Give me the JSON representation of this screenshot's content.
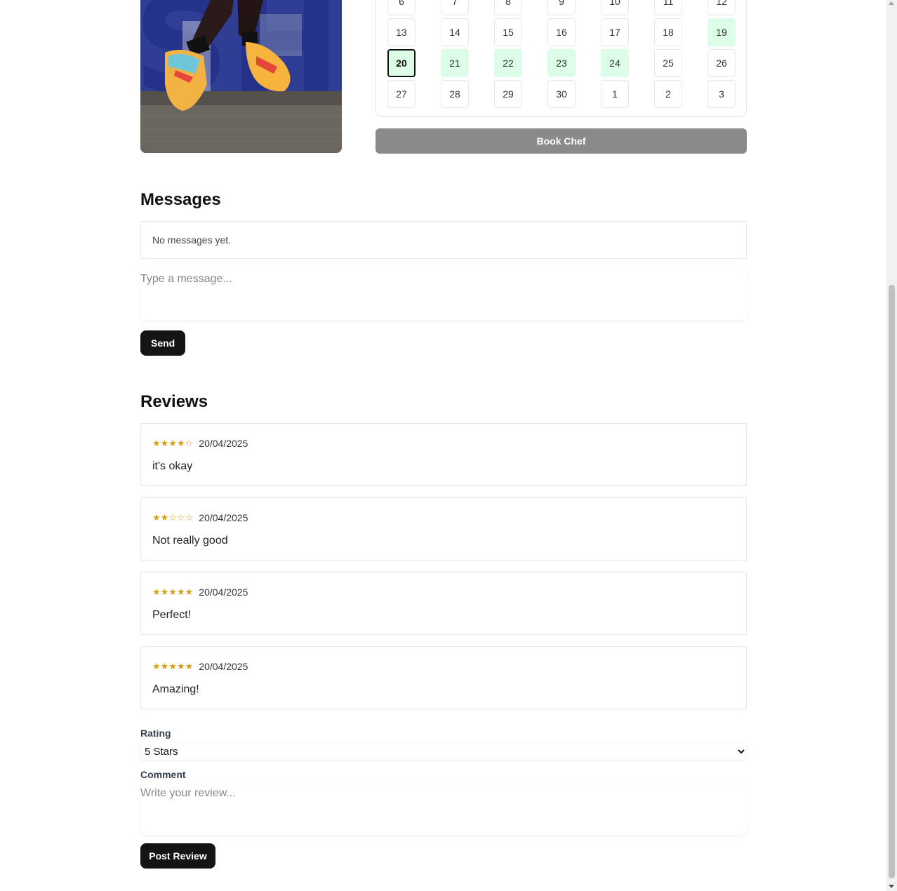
{
  "calendar": {
    "days": [
      {
        "label": "6",
        "state": "normal"
      },
      {
        "label": "7",
        "state": "normal"
      },
      {
        "label": "8",
        "state": "normal"
      },
      {
        "label": "9",
        "state": "normal"
      },
      {
        "label": "10",
        "state": "normal"
      },
      {
        "label": "11",
        "state": "normal"
      },
      {
        "label": "12",
        "state": "normal"
      },
      {
        "label": "13",
        "state": "normal"
      },
      {
        "label": "14",
        "state": "normal"
      },
      {
        "label": "15",
        "state": "normal"
      },
      {
        "label": "16",
        "state": "normal"
      },
      {
        "label": "17",
        "state": "normal"
      },
      {
        "label": "18",
        "state": "normal"
      },
      {
        "label": "19",
        "state": "available"
      },
      {
        "label": "20",
        "state": "today"
      },
      {
        "label": "21",
        "state": "available"
      },
      {
        "label": "22",
        "state": "available"
      },
      {
        "label": "23",
        "state": "available"
      },
      {
        "label": "24",
        "state": "available"
      },
      {
        "label": "25",
        "state": "normal"
      },
      {
        "label": "26",
        "state": "normal"
      },
      {
        "label": "27",
        "state": "normal"
      },
      {
        "label": "28",
        "state": "normal"
      },
      {
        "label": "29",
        "state": "normal"
      },
      {
        "label": "30",
        "state": "normal"
      },
      {
        "label": "1",
        "state": "normal"
      },
      {
        "label": "2",
        "state": "normal"
      },
      {
        "label": "3",
        "state": "normal"
      }
    ],
    "available_color": "#dcfce7"
  },
  "book_button": {
    "label": "Book Chef"
  },
  "messages": {
    "heading": "Messages",
    "empty_text": "No messages yet.",
    "input_placeholder": "Type a message...",
    "send_label": "Send"
  },
  "reviews": {
    "heading": "Reviews",
    "items": [
      {
        "rating": 4,
        "stars": "★★★★☆",
        "date": "20/04/2025",
        "text": "it's okay"
      },
      {
        "rating": 2,
        "stars": "★★☆☆☆",
        "date": "20/04/2025",
        "text": "Not really good"
      },
      {
        "rating": 5,
        "stars": "★★★★★",
        "date": "20/04/2025",
        "text": "Perfect!"
      },
      {
        "rating": 5,
        "stars": "★★★★★",
        "date": "20/04/2025",
        "text": "Amazing!"
      }
    ],
    "star_color": "#d4a017"
  },
  "review_form": {
    "rating_label": "Rating",
    "rating_selected": "5 Stars",
    "comment_label": "Comment",
    "comment_placeholder": "Write your review...",
    "post_label": "Post Review"
  },
  "colors": {
    "primary_button": "#141414",
    "book_button": "#8a8a8a",
    "hero_bg": "#2f3e94"
  }
}
